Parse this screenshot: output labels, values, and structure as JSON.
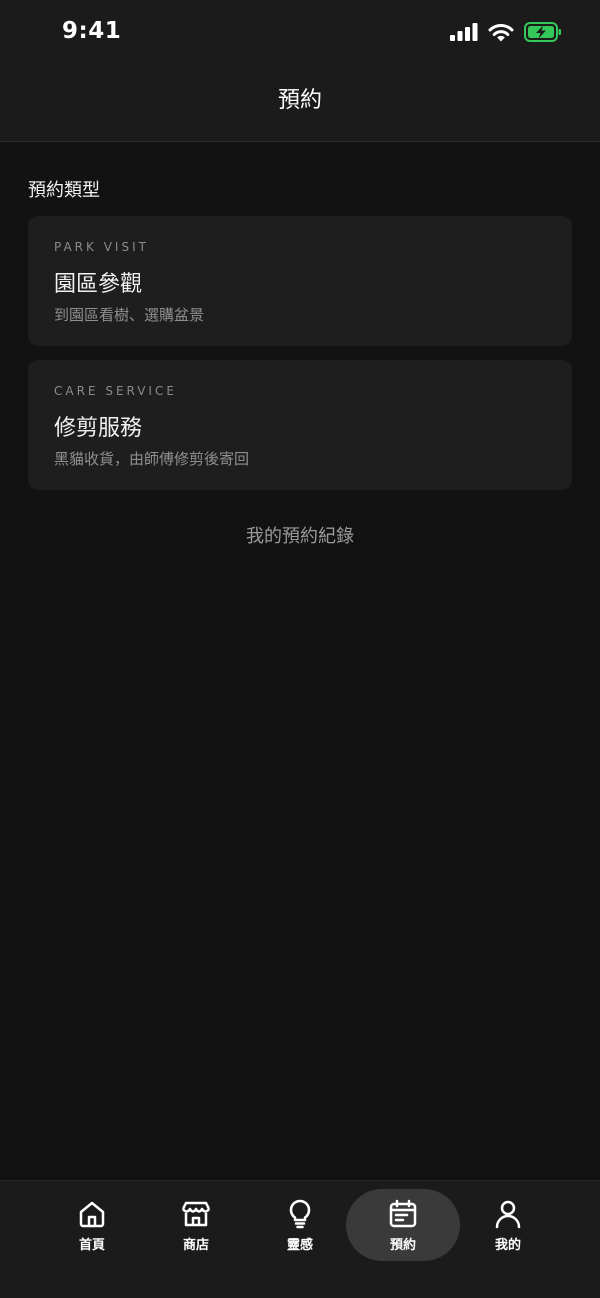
{
  "status_bar": {
    "time": "9:41"
  },
  "header": {
    "title": "預約"
  },
  "section": {
    "title": "預約類型"
  },
  "cards": [
    {
      "eyebrow": "PARK VISIT",
      "title": "園區參觀",
      "description": "到園區看樹、選購盆景"
    },
    {
      "eyebrow": "CARE SERVICE",
      "title": "修剪服務",
      "description": "黑貓收貨，由師傅修剪後寄回"
    }
  ],
  "records_link": "我的預約紀錄",
  "tabs": [
    {
      "label": "首頁",
      "icon": "home-icon"
    },
    {
      "label": "商店",
      "icon": "store-icon"
    },
    {
      "label": "靈感",
      "icon": "lightbulb-icon"
    },
    {
      "label": "預約",
      "icon": "calendar-icon",
      "active": true
    },
    {
      "label": "我的",
      "icon": "user-icon"
    }
  ],
  "colors": {
    "background": "#121212",
    "surface": "#1e1e1e",
    "battery": "#34c759"
  }
}
